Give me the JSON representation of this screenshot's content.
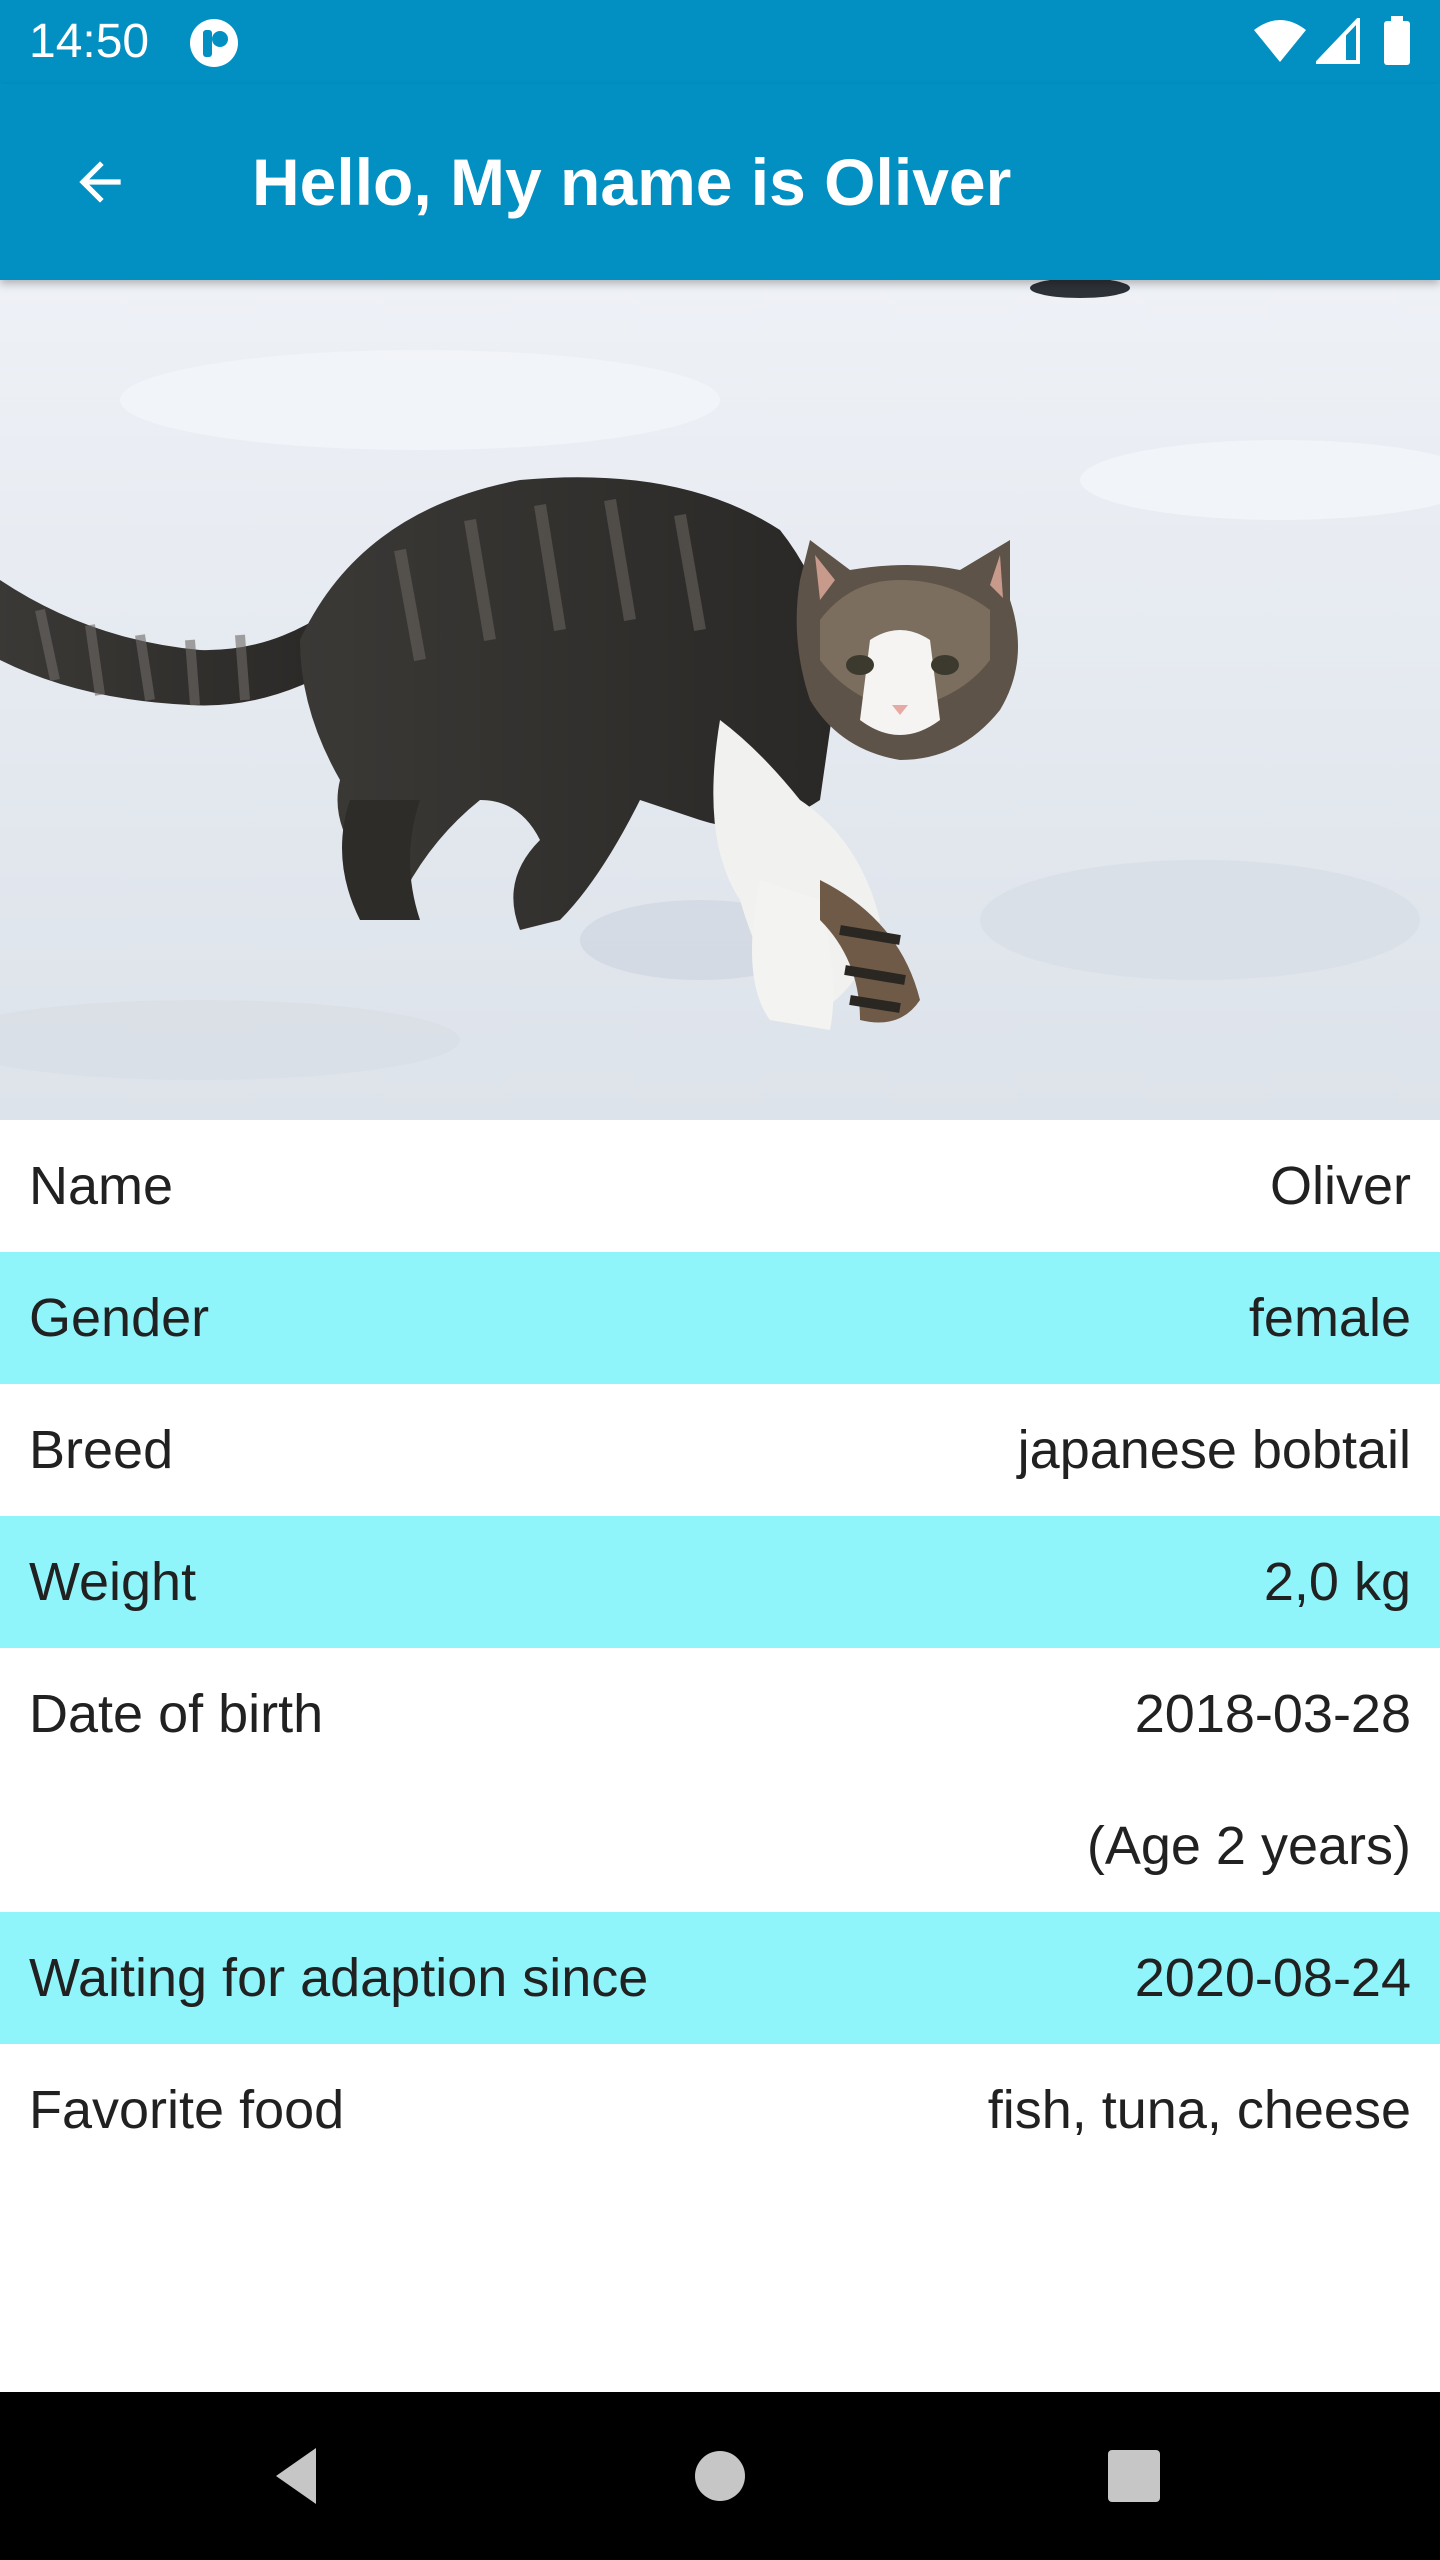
{
  "status_bar": {
    "time": "14:50",
    "icons": [
      "app-notification-icon",
      "wifi-icon",
      "cell-signal-icon",
      "battery-icon"
    ]
  },
  "app_bar": {
    "title": "Hello, My name is Oliver",
    "back_icon": "arrow-back-icon"
  },
  "photo": {
    "icon": "cat-photo"
  },
  "details": [
    {
      "label": "Name",
      "value": "Oliver"
    },
    {
      "label": "Gender",
      "value": "female"
    },
    {
      "label": "Breed",
      "value": "japanese bobtail"
    },
    {
      "label": "Weight",
      "value": "2,0 kg"
    },
    {
      "label": "Date of birth",
      "value": "2018-03-28"
    },
    {
      "label": "",
      "value": "(Age 2 years)"
    },
    {
      "label": "Waiting for adaption since",
      "value": "2020-08-24"
    },
    {
      "label": "Favorite food",
      "value": "fish, tuna, cheese"
    }
  ],
  "nav_bar": {
    "icons": [
      "nav-back-icon",
      "nav-home-icon",
      "nav-recents-icon"
    ]
  },
  "colors": {
    "primary": "#0290c3",
    "row_highlight": "#8ff5fb",
    "text": "#212121",
    "nav_bar": "#000000"
  }
}
